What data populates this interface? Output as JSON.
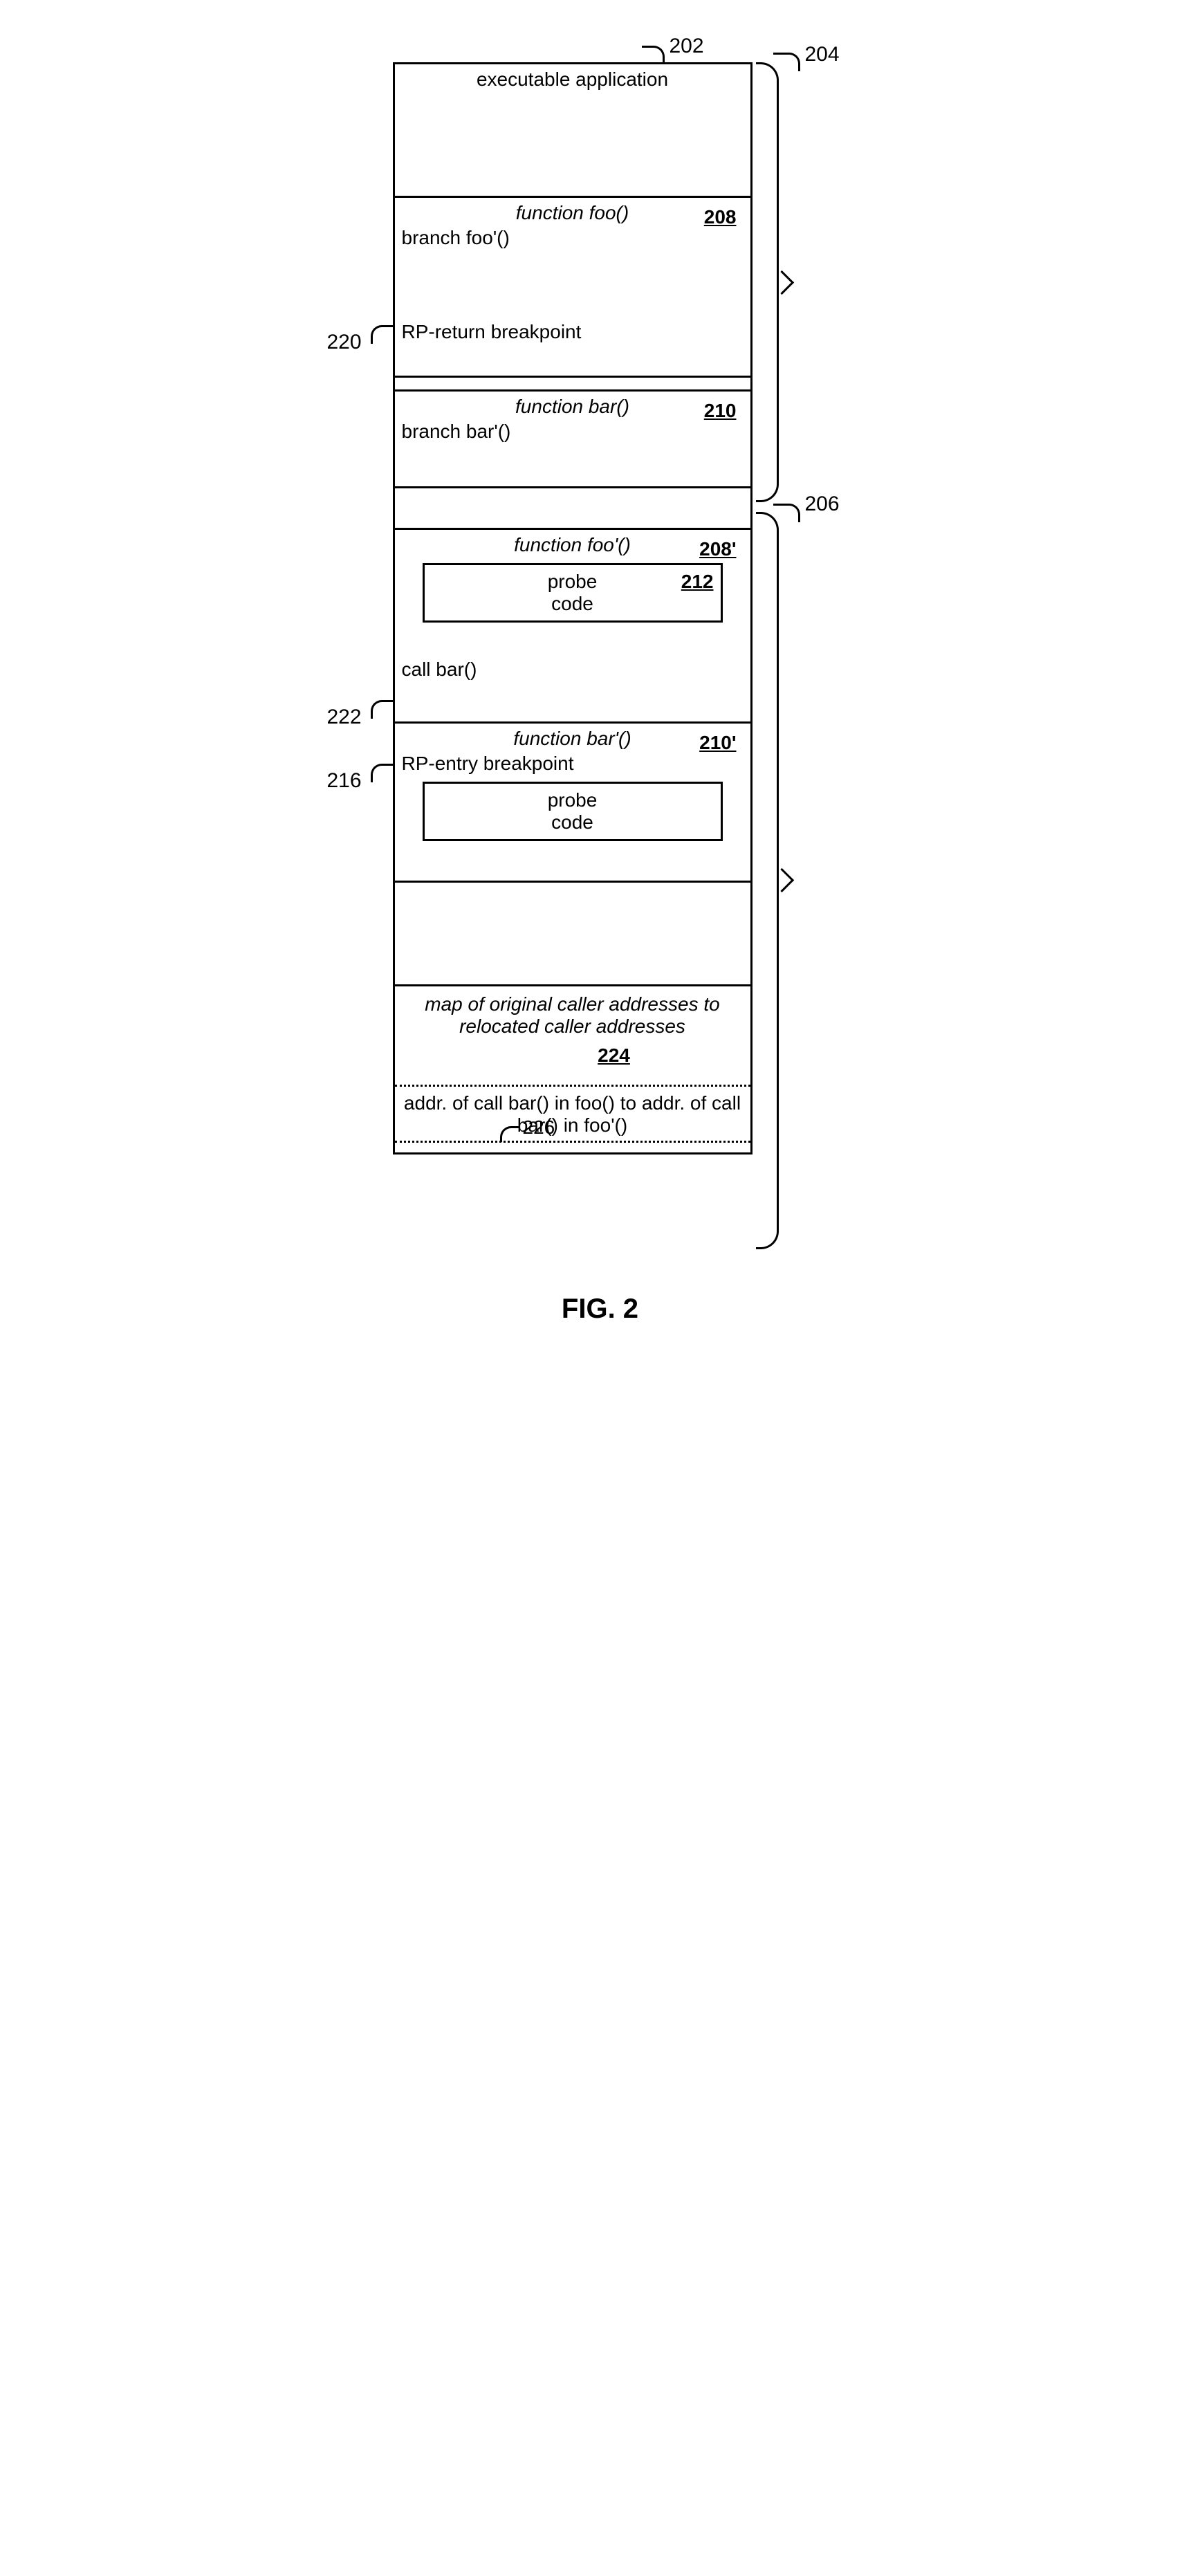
{
  "refs": {
    "col": "202",
    "upper": "204",
    "lower": "206",
    "foo": "208",
    "bar": "210",
    "fooPrime": "208'",
    "barPrime": "210'",
    "probe": "212",
    "bp_return": "220",
    "call_bar": "222",
    "bp_entry": "216",
    "map": "224",
    "map_entry": "226"
  },
  "blocks": {
    "app_title": "executable application",
    "foo_title": "function foo()",
    "foo_branch": "branch foo'()",
    "foo_rp_return": "RP-return breakpoint",
    "bar_title": "function bar()",
    "bar_branch": "branch bar'()",
    "fooP_title": "function foo'()",
    "probe_label": "probe\ncode",
    "fooP_call": "call bar()",
    "barP_title": "function bar'()",
    "barP_rp_entry": "RP-entry breakpoint",
    "map_title": "map of original caller addresses to relocated caller addresses",
    "map_entry_text": "addr. of call bar() in foo() to addr. of call bar() in foo'()"
  },
  "caption": "FIG. 2"
}
